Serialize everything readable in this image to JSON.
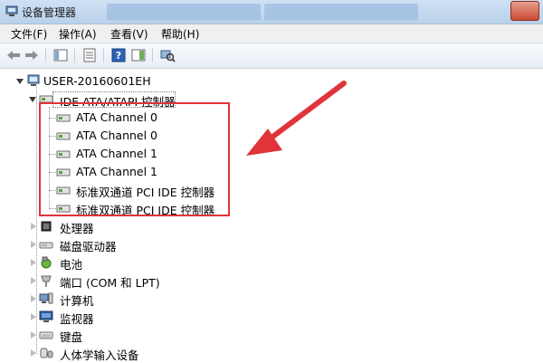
{
  "window": {
    "title": "设备管理器"
  },
  "menu": [
    "文件(F)",
    "操作(A)",
    "查看(V)",
    "帮助(H)"
  ],
  "tree": {
    "root": "USER-20160601EH",
    "ide_group": "IDE ATA/ATAPI 控制器",
    "ide_children": [
      "ATA Channel 0",
      "ATA Channel 0",
      "ATA Channel 1",
      "ATA Channel 1",
      "标准双通道 PCI IDE 控制器",
      "标准双通道 PCI IDE 控制器"
    ],
    "categories": [
      "处理器",
      "磁盘驱动器",
      "电池",
      "端口 (COM 和 LPT)",
      "计算机",
      "监视器",
      "键盘",
      "人体学输入设备"
    ]
  },
  "colors": {
    "annotation": "#e0333a",
    "titlebar": "#c6daf0",
    "toolbar": "#eef2f7"
  },
  "icons": {
    "toolbar": [
      "back-arrow-icon",
      "forward-arrow-icon",
      "show-hide-tree-icon",
      "properties-icon",
      "help-icon",
      "action-pane-icon",
      "scan-hardware-icon"
    ]
  }
}
